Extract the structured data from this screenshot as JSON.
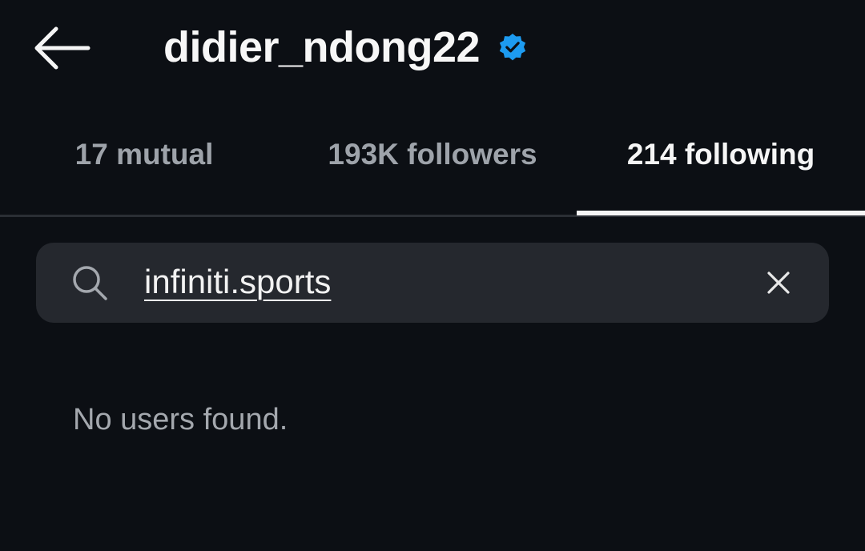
{
  "header": {
    "title": "didier_ndong22",
    "verified": true,
    "back_icon": "arrow-left-icon",
    "verified_icon": "verified-badge-icon",
    "verified_color": "#1d9bf0"
  },
  "tabs": [
    {
      "label": "17 mutual",
      "active": false
    },
    {
      "label": "193K followers",
      "active": false
    },
    {
      "label": "214 following",
      "active": true
    }
  ],
  "search": {
    "value": "infiniti.sports",
    "search_icon": "search-icon",
    "clear_icon": "close-icon"
  },
  "results": {
    "empty_message": "No users found."
  },
  "colors": {
    "background": "#0c0f14",
    "search_background": "#25282e",
    "active_text": "#f5f5f5",
    "inactive_text": "#9ea3aa"
  }
}
